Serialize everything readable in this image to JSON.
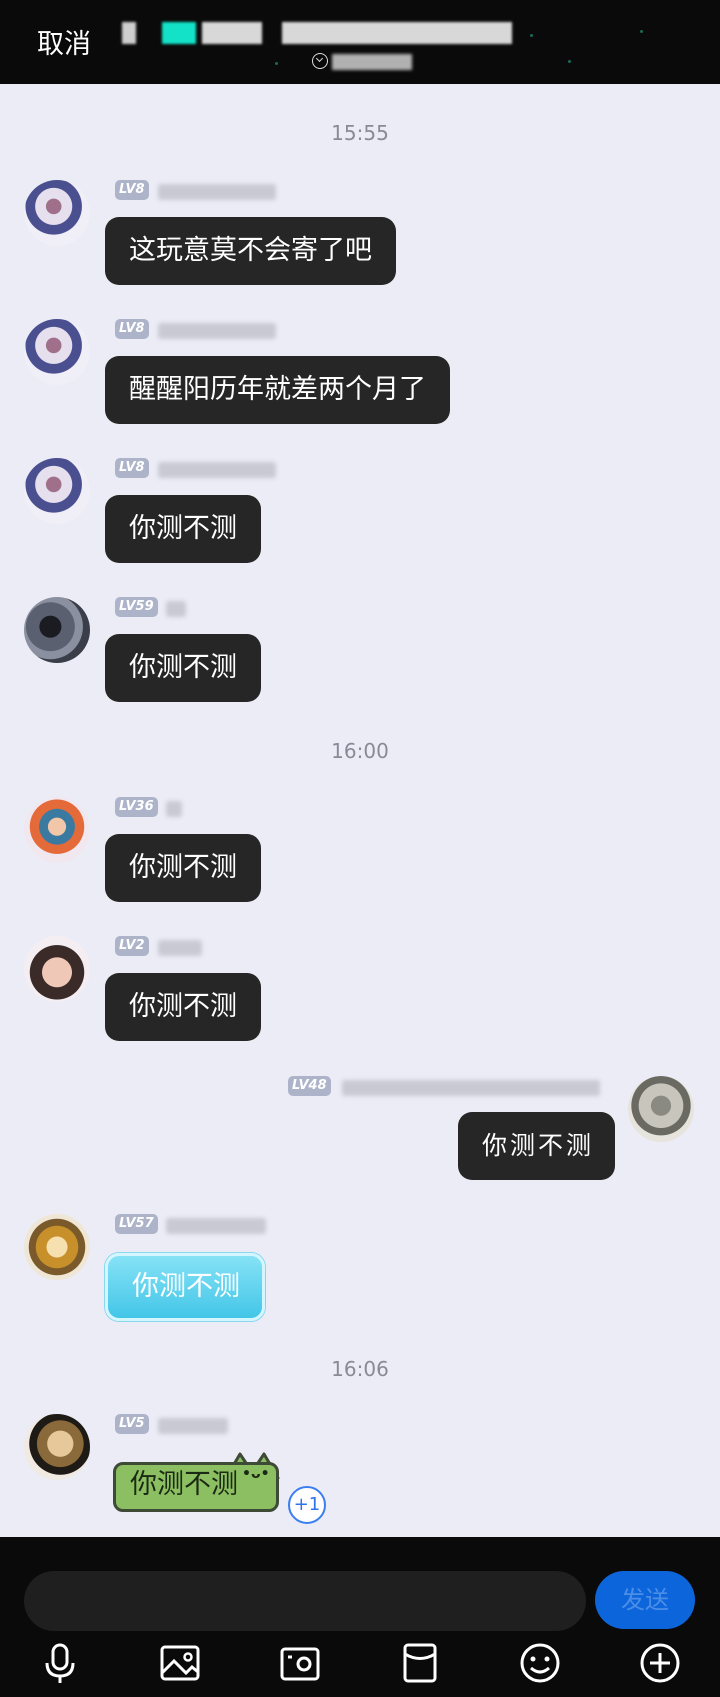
{
  "header": {
    "cancel_label": "取消"
  },
  "messages": [
    {
      "type": "time",
      "text": "15:55"
    },
    {
      "sender": "other",
      "level": "LV8",
      "text": "这玩意莫不会寄了吧"
    },
    {
      "sender": "other",
      "level": "LV8",
      "text": "醒醒阳历年就差两个月了"
    },
    {
      "sender": "other",
      "level": "LV8",
      "text": "你测不测"
    },
    {
      "sender": "other",
      "level": "LV59",
      "text": "你测不测"
    },
    {
      "type": "time",
      "text": "16:00"
    },
    {
      "sender": "other",
      "level": "LV36",
      "text": "你测不测"
    },
    {
      "sender": "other",
      "level": "LV2",
      "text": "你测不测"
    },
    {
      "sender": "self",
      "level": "LV48",
      "text": "你测不测"
    },
    {
      "sender": "other",
      "level": "LV57",
      "text": "你测不测",
      "style": "blue"
    },
    {
      "type": "time",
      "text": "16:06"
    },
    {
      "sender": "other",
      "level": "LV5",
      "text": "你测不测",
      "style": "cat",
      "reaction": "+1"
    }
  ],
  "composer": {
    "send_label": "发送"
  },
  "toolbar": [
    "microphone-icon",
    "image-icon",
    "camera-icon",
    "red-packet-icon",
    "emoji-icon",
    "plus-icon"
  ],
  "colors": {
    "accent": "#0d65dc",
    "background": "#ececf6",
    "bubble": "#262626"
  }
}
